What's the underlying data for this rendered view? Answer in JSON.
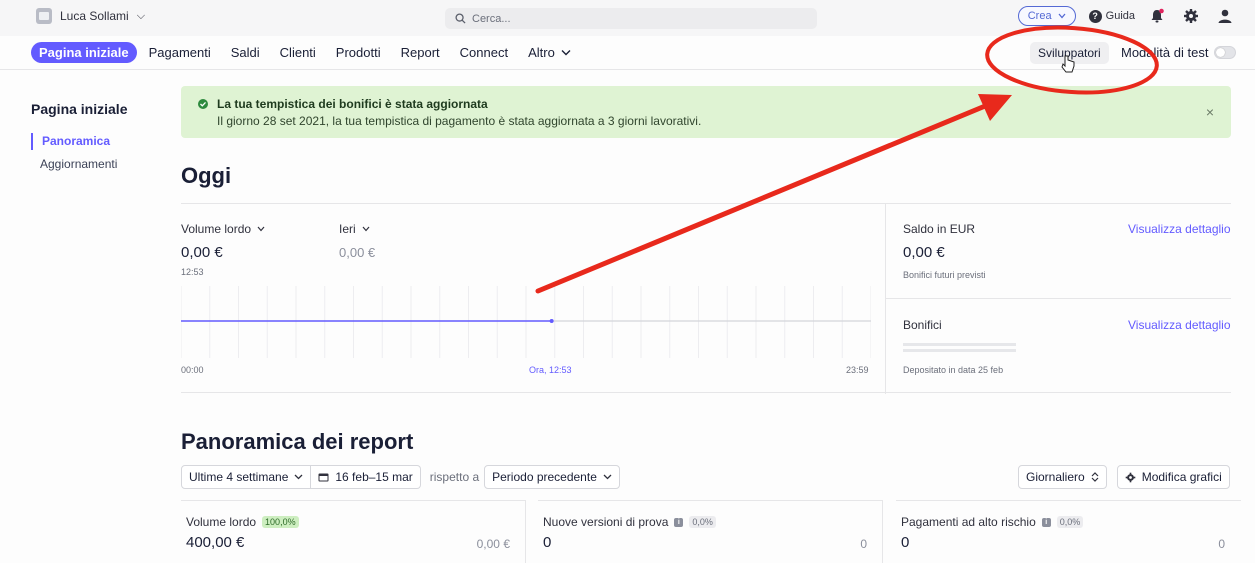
{
  "topbar": {
    "account_name": "Luca Sollami",
    "search_placeholder": "Cerca...",
    "create_label": "Crea",
    "help_label": "Guida"
  },
  "nav": {
    "items": [
      {
        "label": "Pagina iniziale",
        "active": true
      },
      {
        "label": "Pagamenti"
      },
      {
        "label": "Saldi"
      },
      {
        "label": "Clienti"
      },
      {
        "label": "Prodotti"
      },
      {
        "label": "Report"
      },
      {
        "label": "Connect"
      },
      {
        "label": "Altro"
      }
    ],
    "developers_label": "Sviluppatori",
    "test_mode_label": "Modalità di test",
    "test_mode_on": false
  },
  "sidebar": {
    "title": "Pagina iniziale",
    "items": [
      {
        "label": "Panoramica",
        "active": true
      },
      {
        "label": "Aggiornamenti"
      }
    ]
  },
  "banner": {
    "title": "La tua tempistica dei bonifici è stata aggiornata",
    "text": "Il giorno 28 set 2021, la tua tempistica di pagamento è stata aggiornata a 3 giorni lavorativi.",
    "close": "×"
  },
  "today": {
    "heading": "Oggi",
    "gross_label": "Volume lordo",
    "gross_value": "0,00 €",
    "gross_time": "12:53",
    "yesterday_label": "Ieri",
    "yesterday_value": "0,00 €",
    "axis_start": "00:00",
    "axis_now": "Ora, 12:53",
    "axis_end": "23:59",
    "balance_label": "Saldo in EUR",
    "balance_value": "0,00 €",
    "balance_sub": "Bonifici futuri previsti",
    "details_link": "Visualizza dettaglio",
    "payouts_label": "Bonifici",
    "payouts_sub": "Depositato in data 25 feb",
    "payouts_link": "Visualizza dettaglio"
  },
  "reports": {
    "heading": "Panoramica dei report",
    "period": "Ultime 4 settimane",
    "dates": "16 feb–15 mar",
    "compare_label": "rispetto a",
    "compare_period": "Periodo precedente",
    "granularity": "Giornaliero",
    "edit_charts": "Modifica grafici",
    "cards": [
      {
        "label": "Volume lordo",
        "badge": "100,0%",
        "value": "400,00 €",
        "compare": "0,00 €"
      },
      {
        "label": "Nuove versioni di prova",
        "badge": "0,0%",
        "value": "0",
        "compare": "0"
      },
      {
        "label": "Pagamenti ad alto rischio",
        "badge": "0,0%",
        "value": "0",
        "compare": "0"
      }
    ]
  },
  "colors": {
    "accent": "#635bff",
    "banner_bg": "#dff3d3",
    "annotation": "#e8291c"
  },
  "chart_data": {
    "type": "line",
    "x": [
      "00:00",
      "12:53"
    ],
    "values": [
      0,
      0
    ],
    "x_range": [
      "00:00",
      "23:59"
    ],
    "now_label": "Ora, 12:53",
    "grid": true
  }
}
